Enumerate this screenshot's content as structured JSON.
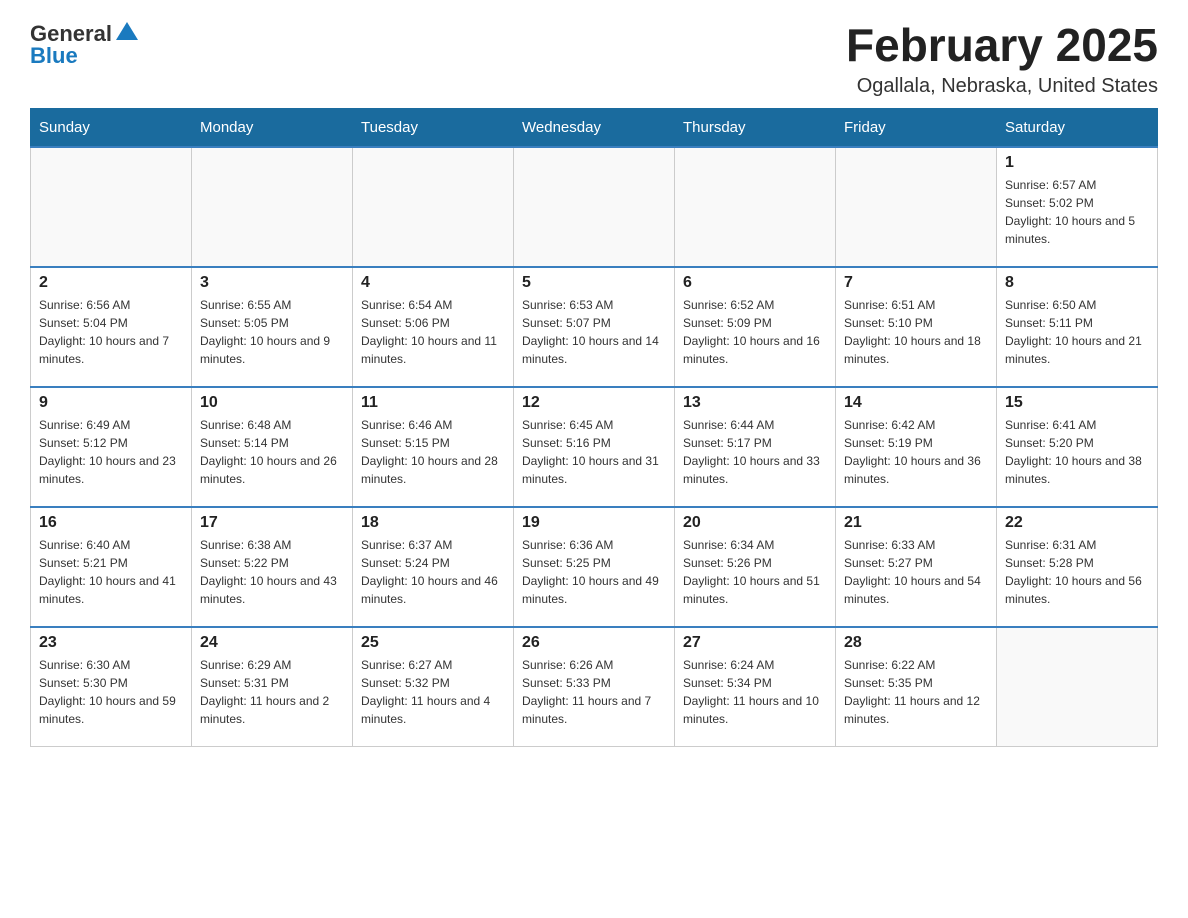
{
  "logo": {
    "text_general": "General",
    "text_blue": "Blue"
  },
  "title": {
    "month_year": "February 2025",
    "location": "Ogallala, Nebraska, United States"
  },
  "days_of_week": [
    "Sunday",
    "Monday",
    "Tuesday",
    "Wednesday",
    "Thursday",
    "Friday",
    "Saturday"
  ],
  "weeks": [
    [
      {
        "day": "",
        "sunrise": "",
        "sunset": "",
        "daylight": ""
      },
      {
        "day": "",
        "sunrise": "",
        "sunset": "",
        "daylight": ""
      },
      {
        "day": "",
        "sunrise": "",
        "sunset": "",
        "daylight": ""
      },
      {
        "day": "",
        "sunrise": "",
        "sunset": "",
        "daylight": ""
      },
      {
        "day": "",
        "sunrise": "",
        "sunset": "",
        "daylight": ""
      },
      {
        "day": "",
        "sunrise": "",
        "sunset": "",
        "daylight": ""
      },
      {
        "day": "1",
        "sunrise": "Sunrise: 6:57 AM",
        "sunset": "Sunset: 5:02 PM",
        "daylight": "Daylight: 10 hours and 5 minutes."
      }
    ],
    [
      {
        "day": "2",
        "sunrise": "Sunrise: 6:56 AM",
        "sunset": "Sunset: 5:04 PM",
        "daylight": "Daylight: 10 hours and 7 minutes."
      },
      {
        "day": "3",
        "sunrise": "Sunrise: 6:55 AM",
        "sunset": "Sunset: 5:05 PM",
        "daylight": "Daylight: 10 hours and 9 minutes."
      },
      {
        "day": "4",
        "sunrise": "Sunrise: 6:54 AM",
        "sunset": "Sunset: 5:06 PM",
        "daylight": "Daylight: 10 hours and 11 minutes."
      },
      {
        "day": "5",
        "sunrise": "Sunrise: 6:53 AM",
        "sunset": "Sunset: 5:07 PM",
        "daylight": "Daylight: 10 hours and 14 minutes."
      },
      {
        "day": "6",
        "sunrise": "Sunrise: 6:52 AM",
        "sunset": "Sunset: 5:09 PM",
        "daylight": "Daylight: 10 hours and 16 minutes."
      },
      {
        "day": "7",
        "sunrise": "Sunrise: 6:51 AM",
        "sunset": "Sunset: 5:10 PM",
        "daylight": "Daylight: 10 hours and 18 minutes."
      },
      {
        "day": "8",
        "sunrise": "Sunrise: 6:50 AM",
        "sunset": "Sunset: 5:11 PM",
        "daylight": "Daylight: 10 hours and 21 minutes."
      }
    ],
    [
      {
        "day": "9",
        "sunrise": "Sunrise: 6:49 AM",
        "sunset": "Sunset: 5:12 PM",
        "daylight": "Daylight: 10 hours and 23 minutes."
      },
      {
        "day": "10",
        "sunrise": "Sunrise: 6:48 AM",
        "sunset": "Sunset: 5:14 PM",
        "daylight": "Daylight: 10 hours and 26 minutes."
      },
      {
        "day": "11",
        "sunrise": "Sunrise: 6:46 AM",
        "sunset": "Sunset: 5:15 PM",
        "daylight": "Daylight: 10 hours and 28 minutes."
      },
      {
        "day": "12",
        "sunrise": "Sunrise: 6:45 AM",
        "sunset": "Sunset: 5:16 PM",
        "daylight": "Daylight: 10 hours and 31 minutes."
      },
      {
        "day": "13",
        "sunrise": "Sunrise: 6:44 AM",
        "sunset": "Sunset: 5:17 PM",
        "daylight": "Daylight: 10 hours and 33 minutes."
      },
      {
        "day": "14",
        "sunrise": "Sunrise: 6:42 AM",
        "sunset": "Sunset: 5:19 PM",
        "daylight": "Daylight: 10 hours and 36 minutes."
      },
      {
        "day": "15",
        "sunrise": "Sunrise: 6:41 AM",
        "sunset": "Sunset: 5:20 PM",
        "daylight": "Daylight: 10 hours and 38 minutes."
      }
    ],
    [
      {
        "day": "16",
        "sunrise": "Sunrise: 6:40 AM",
        "sunset": "Sunset: 5:21 PM",
        "daylight": "Daylight: 10 hours and 41 minutes."
      },
      {
        "day": "17",
        "sunrise": "Sunrise: 6:38 AM",
        "sunset": "Sunset: 5:22 PM",
        "daylight": "Daylight: 10 hours and 43 minutes."
      },
      {
        "day": "18",
        "sunrise": "Sunrise: 6:37 AM",
        "sunset": "Sunset: 5:24 PM",
        "daylight": "Daylight: 10 hours and 46 minutes."
      },
      {
        "day": "19",
        "sunrise": "Sunrise: 6:36 AM",
        "sunset": "Sunset: 5:25 PM",
        "daylight": "Daylight: 10 hours and 49 minutes."
      },
      {
        "day": "20",
        "sunrise": "Sunrise: 6:34 AM",
        "sunset": "Sunset: 5:26 PM",
        "daylight": "Daylight: 10 hours and 51 minutes."
      },
      {
        "day": "21",
        "sunrise": "Sunrise: 6:33 AM",
        "sunset": "Sunset: 5:27 PM",
        "daylight": "Daylight: 10 hours and 54 minutes."
      },
      {
        "day": "22",
        "sunrise": "Sunrise: 6:31 AM",
        "sunset": "Sunset: 5:28 PM",
        "daylight": "Daylight: 10 hours and 56 minutes."
      }
    ],
    [
      {
        "day": "23",
        "sunrise": "Sunrise: 6:30 AM",
        "sunset": "Sunset: 5:30 PM",
        "daylight": "Daylight: 10 hours and 59 minutes."
      },
      {
        "day": "24",
        "sunrise": "Sunrise: 6:29 AM",
        "sunset": "Sunset: 5:31 PM",
        "daylight": "Daylight: 11 hours and 2 minutes."
      },
      {
        "day": "25",
        "sunrise": "Sunrise: 6:27 AM",
        "sunset": "Sunset: 5:32 PM",
        "daylight": "Daylight: 11 hours and 4 minutes."
      },
      {
        "day": "26",
        "sunrise": "Sunrise: 6:26 AM",
        "sunset": "Sunset: 5:33 PM",
        "daylight": "Daylight: 11 hours and 7 minutes."
      },
      {
        "day": "27",
        "sunrise": "Sunrise: 6:24 AM",
        "sunset": "Sunset: 5:34 PM",
        "daylight": "Daylight: 11 hours and 10 minutes."
      },
      {
        "day": "28",
        "sunrise": "Sunrise: 6:22 AM",
        "sunset": "Sunset: 5:35 PM",
        "daylight": "Daylight: 11 hours and 12 minutes."
      },
      {
        "day": "",
        "sunrise": "",
        "sunset": "",
        "daylight": ""
      }
    ]
  ]
}
